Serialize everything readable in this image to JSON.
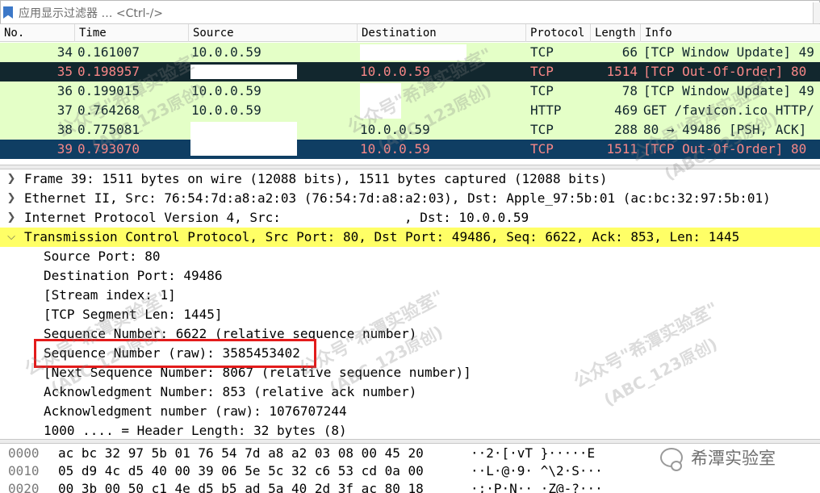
{
  "filter": {
    "placeholder": "应用显示过滤器 … <Ctrl-/>"
  },
  "packet_list": {
    "columns": [
      "No.",
      "Time",
      "Source",
      "Destination",
      "Protocol",
      "Length",
      "Info"
    ],
    "rows": [
      {
        "no": "34",
        "time": "0.161007",
        "source": "10.0.0.59",
        "destination": "",
        "protocol": "TCP",
        "length": "66",
        "info": "[TCP Window Update] 49",
        "style": "green"
      },
      {
        "no": "35",
        "time": "0.198957",
        "source": "",
        "destination": "10.0.0.59",
        "protocol": "TCP",
        "length": "1514",
        "info": "[TCP Out-Of-Order] 80",
        "style": "dark"
      },
      {
        "no": "36",
        "time": "0.199015",
        "source": "10.0.0.59",
        "destination": "",
        "protocol": "TCP",
        "length": "78",
        "info": "[TCP Window Update] 49",
        "style": "green"
      },
      {
        "no": "37",
        "time": "0.764268",
        "source": "10.0.0.59",
        "destination": "",
        "protocol": "HTTP",
        "length": "469",
        "info": "GET /favicon.ico HTTP/",
        "style": "green"
      },
      {
        "no": "38",
        "time": "0.775081",
        "source": "",
        "destination": "10.0.0.59",
        "protocol": "TCP",
        "length": "288",
        "info": "80 → 49486 [PSH, ACK]",
        "style": "green"
      },
      {
        "no": "39",
        "time": "0.793070",
        "source": "",
        "destination": "10.0.0.59",
        "protocol": "TCP",
        "length": "1511",
        "info": "[TCP Out-Of-Order] 80",
        "style": "selected"
      }
    ]
  },
  "details": {
    "frame": "Frame 39: 1511 bytes on wire (12088 bits), 1511 bytes captured (12088 bits)",
    "ethernet": "Ethernet II, Src: 76:54:7d:a8:a2:03 (76:54:7d:a8:a2:03), Dst: Apple_97:5b:01 (ac:bc:32:97:5b:01)",
    "ip_prefix": "Internet Protocol Version 4, Src:",
    "ip_suffix": ", Dst: 10.0.0.59",
    "tcp": "Transmission Control Protocol, Src Port: 80, Dst Port: 49486, Seq: 6622, Ack: 853, Len: 1445",
    "fields": [
      "Source Port: 80",
      "Destination Port: 49486",
      "[Stream index: 1]",
      "[TCP Segment Len: 1445]",
      "Sequence Number: 6622    (relative sequence number)",
      "Sequence Number (raw): 3585453402",
      "[Next Sequence Number: 8067    (relative sequence number)]",
      "Acknowledgment Number: 853    (relative ack number)",
      "Acknowledgment number (raw): 1076707244",
      "1000 .... = Header Length: 32 bytes (8)"
    ]
  },
  "bytes": [
    {
      "offset": "0000",
      "hex": "ac bc 32 97 5b 01 76 54  7d a8 a2 03 08 00 45 20",
      "ascii": "··2·[·vT }·····E"
    },
    {
      "offset": "0010",
      "hex": "05 d9 4c d5 40 00 39 06  5e 5c 32 c6 53 cd 0a 00",
      "ascii": "··L·@·9· ^\\2·S···"
    },
    {
      "offset": "0020",
      "hex": "00 3b 00 50 c1 4e d5 b5  ad 5a 40 2d 3f ac 80 18",
      "ascii": "·;·P·N·· ·Z@-?···"
    }
  ],
  "watermark": {
    "line1": "公众号\"希潭实验室\"",
    "line2": "(ABC_123原创)"
  },
  "logo": {
    "text": "希潭实验室",
    "icon": "wechat-icon"
  },
  "colors": {
    "green_row": "#e4ffc7",
    "dark_row": "#12272e",
    "selected_row": "#0f3e63",
    "out_of_order_text": "#f78787",
    "highlight_row": "#ffff66",
    "annotation_box": "#e31b1b"
  }
}
